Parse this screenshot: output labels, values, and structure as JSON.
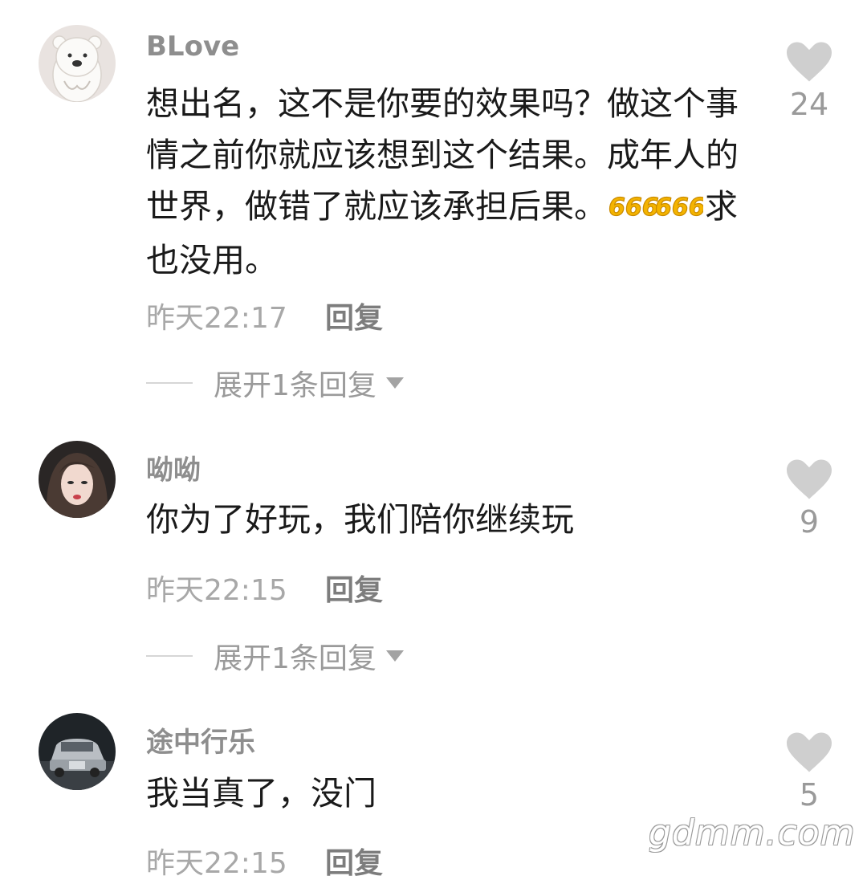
{
  "comments": [
    {
      "username": "BLove",
      "content_before": "想出名，这不是你要的效果吗？做这个事情之前你就应该想到这个结果。成年人的世界，做错了就应该承担后果。",
      "emoji": "666-emoji",
      "content_after": "求也没用。",
      "time": "昨天22:17",
      "reply_label": "回复",
      "expand_label": "展开1条回复",
      "likes": "24",
      "avatar_icon": "polar-bear-avatar"
    },
    {
      "username": "呦呦",
      "content": "你为了好玩，我们陪你继续玩",
      "time": "昨天22:15",
      "reply_label": "回复",
      "expand_label": "展开1条回复",
      "likes": "9",
      "avatar_icon": "woman-portrait-avatar"
    },
    {
      "username": "途中行乐",
      "content": "我当真了，没门",
      "time": "昨天22:15",
      "reply_label": "回复",
      "likes": "5",
      "avatar_icon": "suv-car-avatar"
    }
  ],
  "watermark": "gdmm.com",
  "colors": {
    "username": "#8e8e8e",
    "content": "#1a1a1a",
    "meta": "#a8a8a8",
    "heart": "#cfcfcf"
  }
}
